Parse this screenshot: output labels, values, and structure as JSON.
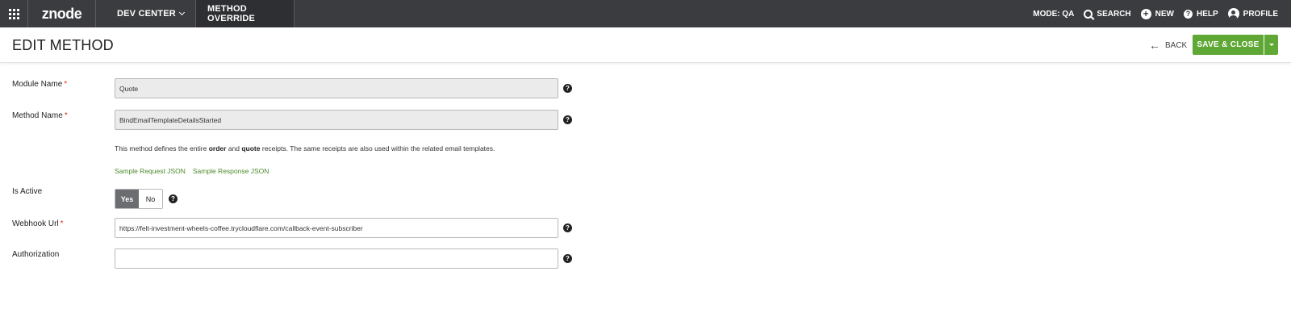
{
  "topbar": {
    "logo": "znode",
    "dev_center": "DEV CENTER",
    "active_tab": "METHOD OVERRIDE",
    "mode": "MODE: QA",
    "search": "SEARCH",
    "new": "NEW",
    "help": "HELP",
    "profile": "PROFILE"
  },
  "header": {
    "title": "EDIT METHOD",
    "back": "BACK",
    "save_close": "SAVE & CLOSE"
  },
  "form": {
    "module_name": {
      "label": "Module Name",
      "required_mark": "*",
      "value": "Quote"
    },
    "method_name": {
      "label": "Method Name",
      "required_mark": "*",
      "value": "BindEmailTemplateDetailsStarted"
    },
    "description": {
      "part1": "This method defines the entire ",
      "bold1": "order",
      "part2": " and ",
      "bold2": "quote",
      "part3": " receipts. The same receipts are also used within the related email templates."
    },
    "links": {
      "sample_request": "Sample Request JSON",
      "sample_response": "Sample Response JSON"
    },
    "is_active": {
      "label": "Is Active",
      "yes": "Yes",
      "no": "No",
      "selected": "Yes"
    },
    "webhook_url": {
      "label": "Webhook Url",
      "required_mark": "*",
      "value": "https://felt-investment-wheels-coffee.trycloudflare.com/callback-event-subscriber"
    },
    "authorization": {
      "label": "Authorization",
      "value": ""
    }
  },
  "colors": {
    "topbar": "#3a3c3f",
    "save_green": "#5fa836",
    "link_green": "#4c8a2a",
    "required_red": "#d9342b"
  },
  "icons": {
    "apps": "apps-grid-icon",
    "search": "search-icon",
    "new": "plus-circle-icon",
    "help": "help-circle-icon",
    "profile": "user-circle-icon",
    "back": "arrow-left-icon",
    "info": "question-circle-icon"
  }
}
